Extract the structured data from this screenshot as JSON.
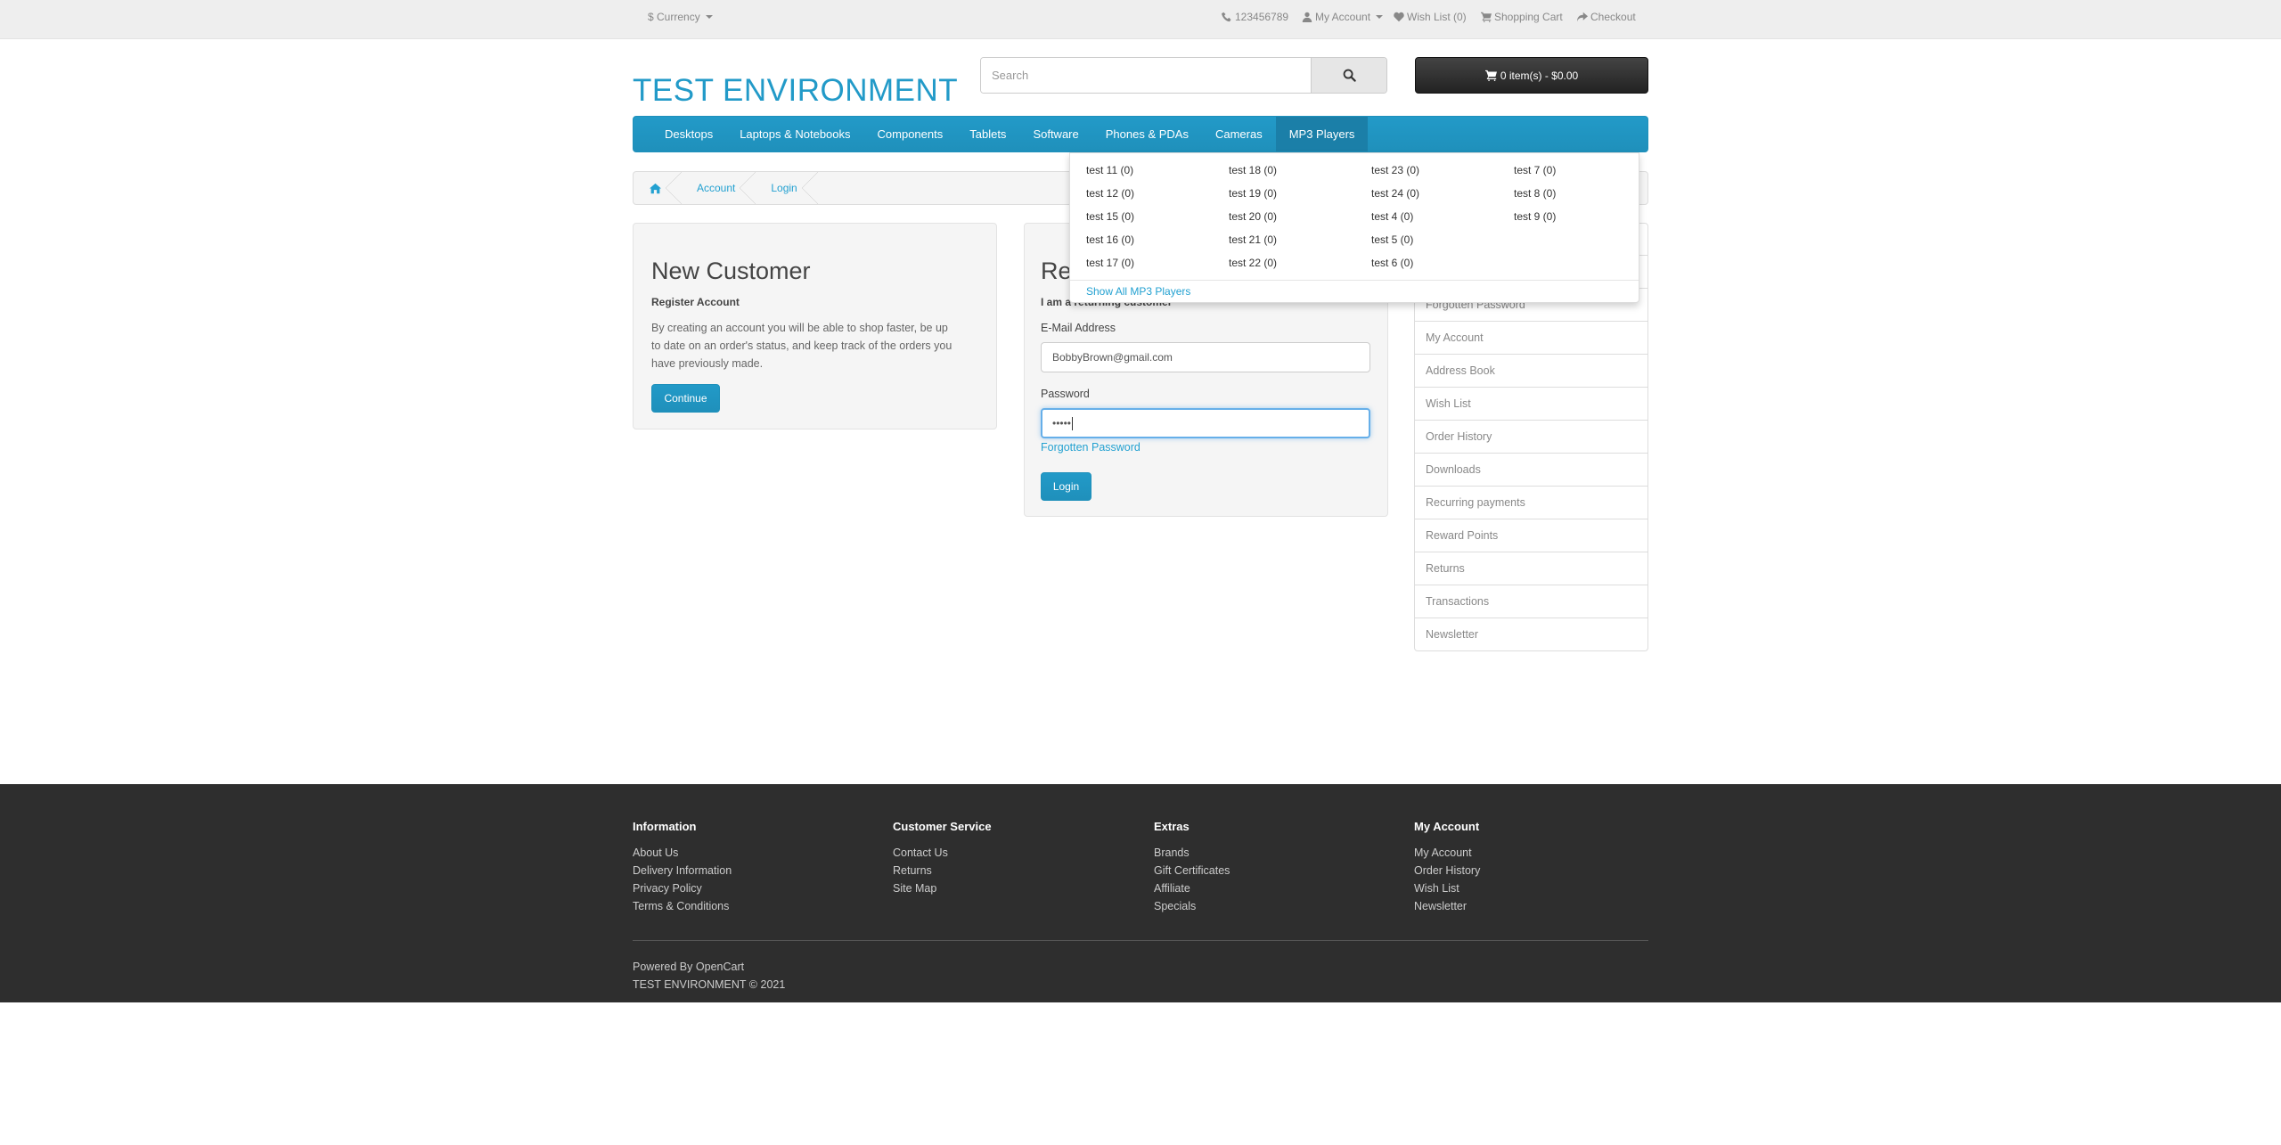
{
  "topbar": {
    "currency_label": "$ Currency",
    "phone": "123456789",
    "my_account": "My Account",
    "wish_list": "Wish List (0)",
    "shopping_cart": "Shopping Cart",
    "checkout": "Checkout"
  },
  "header": {
    "logo": "TEST ENVIRONMENT",
    "search_placeholder": "Search",
    "cart_label": "0 item(s) - $0.00"
  },
  "menu": {
    "items": [
      "Desktops",
      "Laptops & Notebooks",
      "Components",
      "Tablets",
      "Software",
      "Phones & PDAs",
      "Cameras",
      "MP3 Players"
    ],
    "active_index": 7
  },
  "dropdown": {
    "columns": [
      [
        "test 11 (0)",
        "test 12 (0)",
        "test 15 (0)",
        "test 16 (0)",
        "test 17 (0)"
      ],
      [
        "test 18 (0)",
        "test 19 (0)",
        "test 20 (0)",
        "test 21 (0)",
        "test 22 (0)"
      ],
      [
        "test 23 (0)",
        "test 24 (0)",
        "test 4 (0)",
        "test 5 (0)",
        "test 6 (0)"
      ],
      [
        "test 7 (0)",
        "test 8 (0)",
        "test 9 (0)"
      ]
    ],
    "show_all": "Show All MP3 Players"
  },
  "breadcrumb": [
    "Account",
    "Login"
  ],
  "new_customer": {
    "title": "New Customer",
    "subtitle": "Register Account",
    "text": "By creating an account you will be able to shop faster, be up to date on an order's status, and keep track of the orders you have previously made.",
    "button": "Continue"
  },
  "returning": {
    "title": "Re",
    "subtitle": "I am a returning customer",
    "email_label": "E-Mail Address",
    "email_value": "BobbyBrown@gmail.com",
    "password_label": "Password",
    "password_value": "•••••",
    "forgotten": "Forgotten Password",
    "button": "Login"
  },
  "account_list": [
    "Forgotten Password",
    "My Account",
    "Address Book",
    "Wish List",
    "Order History",
    "Downloads",
    "Recurring payments",
    "Reward Points",
    "Returns",
    "Transactions",
    "Newsletter"
  ],
  "footer": {
    "columns": [
      {
        "title": "Information",
        "links": [
          "About Us",
          "Delivery Information",
          "Privacy Policy",
          "Terms & Conditions"
        ]
      },
      {
        "title": "Customer Service",
        "links": [
          "Contact Us",
          "Returns",
          "Site Map"
        ]
      },
      {
        "title": "Extras",
        "links": [
          "Brands",
          "Gift Certificates",
          "Affiliate",
          "Specials"
        ]
      },
      {
        "title": "My Account",
        "links": [
          "My Account",
          "Order History",
          "Wish List",
          "Newsletter"
        ]
      }
    ],
    "powered_prefix": "Powered By",
    "powered_link": "OpenCart",
    "copyright": "TEST ENVIRONMENT © 2021"
  },
  "colors": {
    "brand": "#229ac8",
    "footer_bg": "#2e2e2e",
    "cart_bg": "#363636"
  }
}
